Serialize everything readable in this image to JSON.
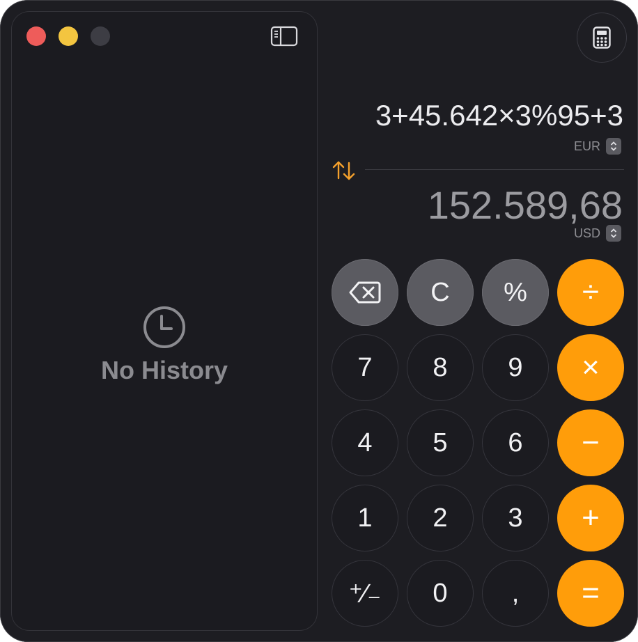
{
  "window": {
    "traffic_lights": {
      "close_color": "#ee5c5a",
      "minimize_color": "#f3c540",
      "zoom_color": "#3d3d44"
    }
  },
  "sidebar": {
    "toggle_icon": "sidebar-toggle-icon",
    "empty_icon": "clock-icon",
    "empty_text": "No History"
  },
  "header": {
    "mode_icon": "calculator-icon"
  },
  "display": {
    "expression": "3+45.642×3%95+3",
    "from_currency": "EUR",
    "swap_icon": "swap-arrows-icon",
    "result": "152.589,68",
    "to_currency": "USD"
  },
  "keypad": {
    "backspace_icon": "backspace-icon",
    "clear": "C",
    "percent": "%",
    "divide": "÷",
    "seven": "7",
    "eight": "8",
    "nine": "9",
    "multiply": "×",
    "four": "4",
    "five": "5",
    "six": "6",
    "subtract": "−",
    "one": "1",
    "two": "2",
    "three": "3",
    "add": "+",
    "plus_minus": "⁺∕₋",
    "zero": "0",
    "decimal": ",",
    "equals": "="
  },
  "colors": {
    "accent": "#ff9d0a",
    "function_key": "#5b5b61",
    "number_key": "#1b1b20",
    "window_bg": "#1d1d22"
  }
}
